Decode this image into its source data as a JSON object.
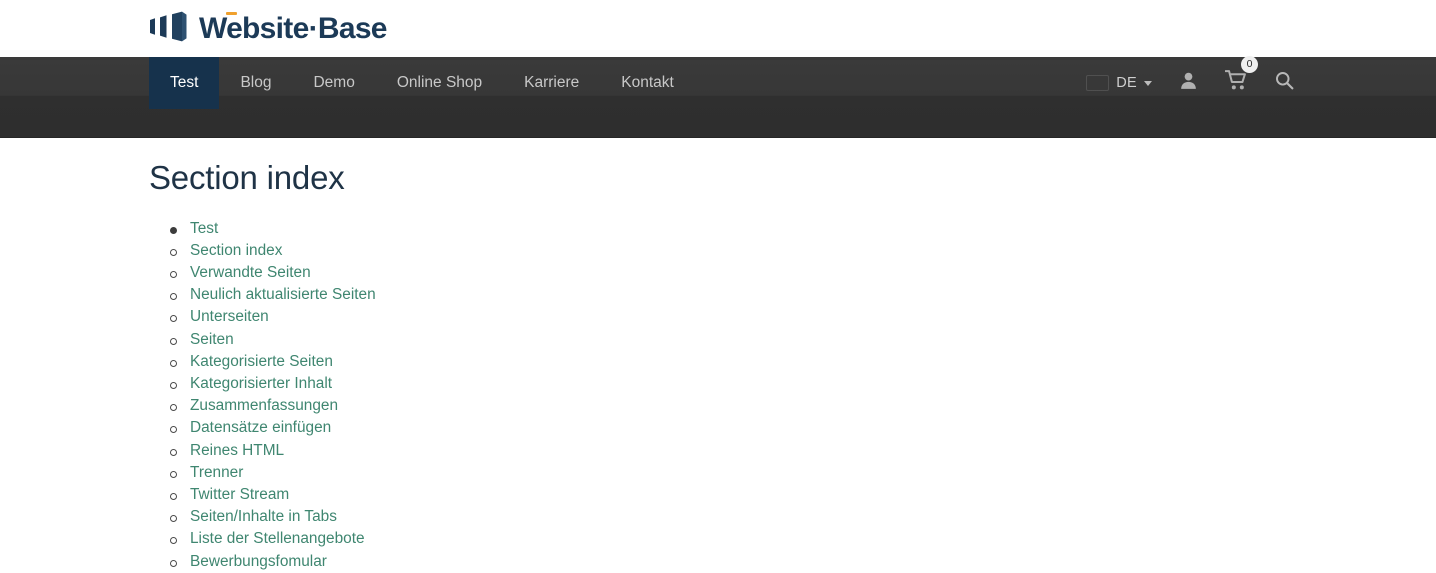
{
  "brand": {
    "logo_text": "Website·Base",
    "logo_icon": "bars-logo-icon",
    "accent_color": "#f0a12e",
    "text_color": "#1c3a57"
  },
  "nav": {
    "items": [
      {
        "label": "Test",
        "active": true
      },
      {
        "label": "Blog",
        "active": false
      },
      {
        "label": "Demo",
        "active": false
      },
      {
        "label": "Online Shop",
        "active": false
      },
      {
        "label": "Karriere",
        "active": false
      },
      {
        "label": "Kontakt",
        "active": false
      }
    ],
    "active_bg": "#16324c",
    "bar_bg": "#373737"
  },
  "tools": {
    "language": {
      "code": "DE",
      "flag_icon": "german-flag-icon",
      "flag_colors": [
        "#000000",
        "#dd0000",
        "#ffce00"
      ],
      "caret_icon": "chevron-down-icon"
    },
    "account": {
      "icon": "user-icon",
      "label": ""
    },
    "cart": {
      "icon": "shopping-cart-icon",
      "count": "0"
    },
    "search": {
      "icon": "search-icon"
    }
  },
  "main": {
    "title": "Section index",
    "items": [
      {
        "label": "Test",
        "level": 0
      },
      {
        "label": "Section index",
        "level": 1
      },
      {
        "label": "Verwandte Seiten",
        "level": 1
      },
      {
        "label": "Neulich aktualisierte Seiten",
        "level": 1
      },
      {
        "label": "Unterseiten",
        "level": 1
      },
      {
        "label": "Seiten",
        "level": 1
      },
      {
        "label": "Kategorisierte Seiten",
        "level": 1
      },
      {
        "label": "Kategorisierter Inhalt",
        "level": 1
      },
      {
        "label": "Zusammenfassungen",
        "level": 1
      },
      {
        "label": "Datensätze einfügen",
        "level": 1
      },
      {
        "label": "Reines HTML",
        "level": 1
      },
      {
        "label": "Trenner",
        "level": 1
      },
      {
        "label": "Twitter Stream",
        "level": 1
      },
      {
        "label": "Seiten/Inhalte in Tabs",
        "level": 1
      },
      {
        "label": "Liste der Stellenangebote",
        "level": 1
      },
      {
        "label": "Bewerbungsfomular",
        "level": 1
      }
    ],
    "link_color": "#3f8670",
    "title_color": "#1f3346"
  }
}
